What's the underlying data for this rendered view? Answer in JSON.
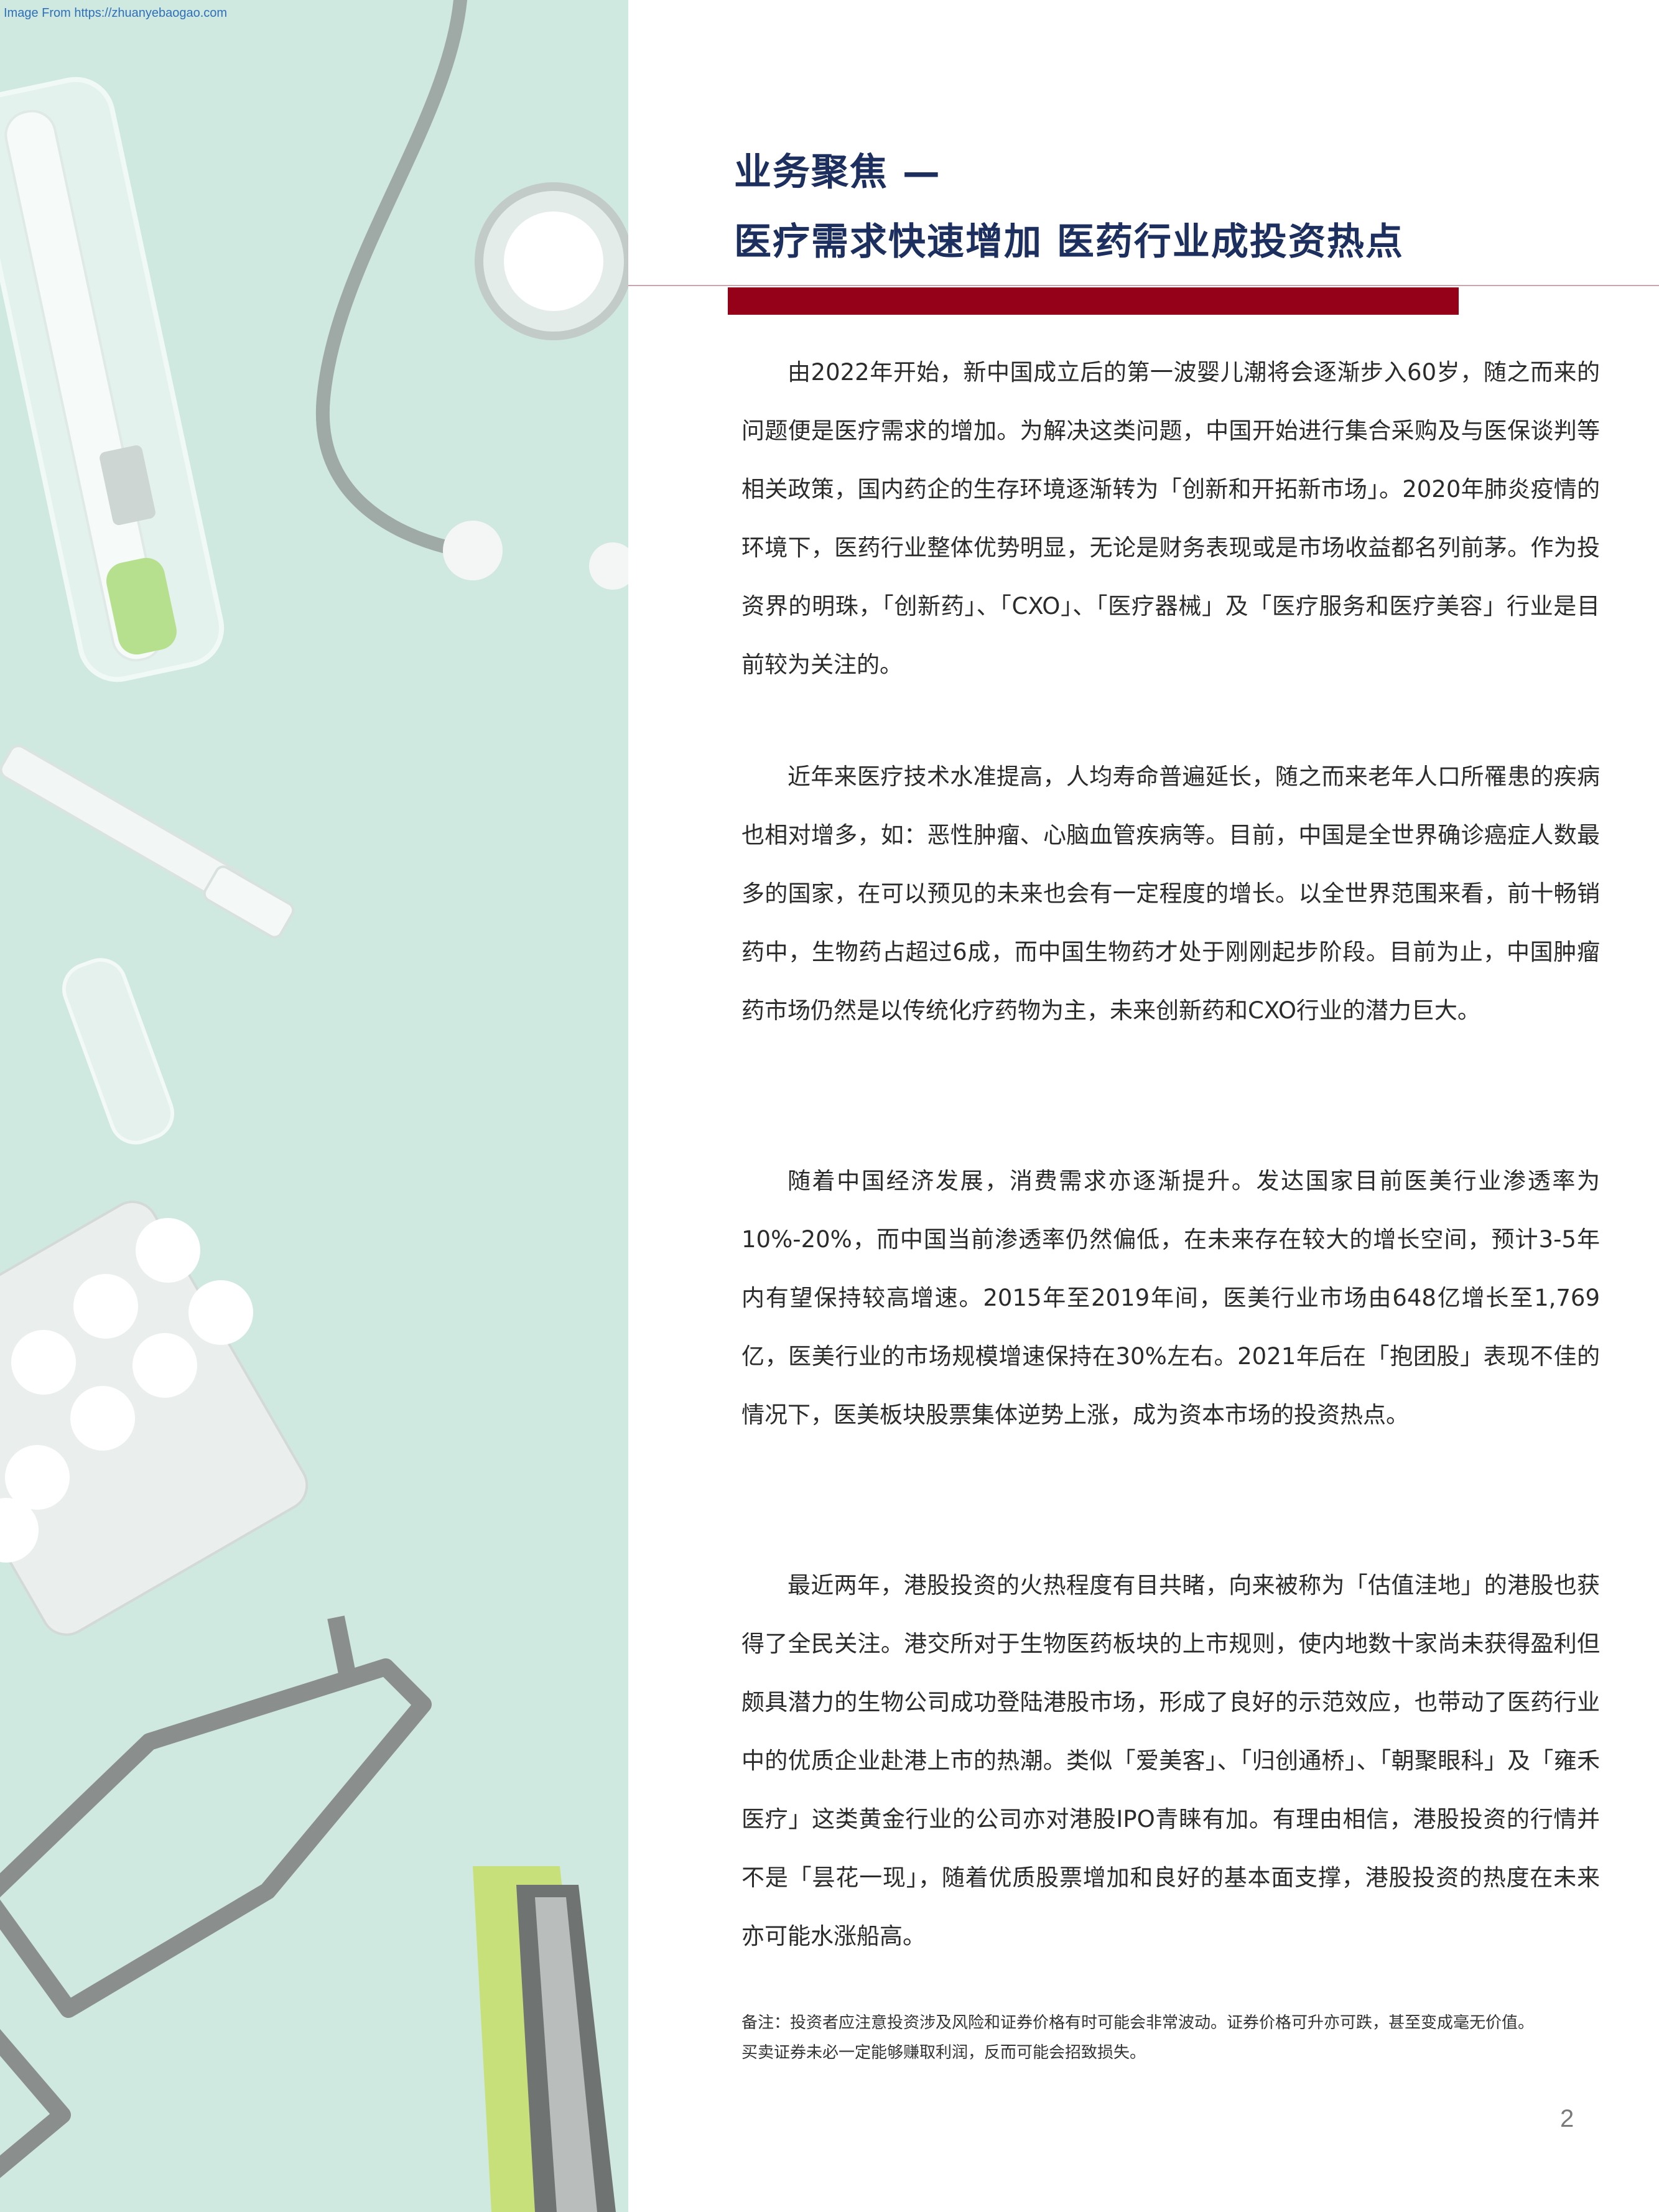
{
  "source_note": "Image From https://zhuanyebaogao.com",
  "title": {
    "line1": "业务聚焦 —",
    "line2": "医疗需求快速增加 医药行业成投资热点"
  },
  "paragraphs": [
    "由2022年开始，新中国成立后的第一波婴儿潮将会逐渐步入60岁，随之而来的问题便是医疗需求的增加。为解决这类问题，中国开始进行集合采购及与医保谈判等相关政策，国内药企的生存环境逐渐转为「创新和开拓新市场」。2020年肺炎疫情的环境下，医药行业整体优势明显，无论是财务表现或是市场收益都名列前茅。作为投资界的明珠，「创新药」、「CXO」、「医疗器械」及「医疗服务和医疗美容」行业是目前较为关注的。",
    "近年来医疗技术水准提高，人均寿命普遍延长，随之而来老年人口所罹患的疾病也相对增多，如：恶性肿瘤、心脑血管疾病等。目前，中国是全世界确诊癌症人数最多的国家，在可以预见的未来也会有一定程度的增长。以全世界范围来看，前十畅销药中，生物药占超过6成，而中国生物药才处于刚刚起步阶段。目前为止，中国肿瘤药市场仍然是以传统化疗药物为主，未来创新药和CXO行业的潜力巨大。",
    "随着中国经济发展，消费需求亦逐渐提升。发达国家目前医美行业渗透率为10%-20%，而中国当前渗透率仍然偏低，在未来存在较大的增长空间，预计3-5年内有望保持较高增速。2015年至2019年间，医美行业市场由648亿增长至1,769亿，医美行业的市场规模增速保持在30%左右。2021年后在「抱团股」表现不佳的情况下，医美板块股票集体逆势上涨，成为资本市场的投资热点。",
    "最近两年，港股投资的火热程度有目共睹，向来被称为「估值洼地」的港股也获得了全民关注。港交所对于生物医药板块的上市规则，使内地数十家尚未获得盈利但颇具潜力的生物公司成功登陆港股市场，形成了良好的示范效应，也带动了医药行业中的优质企业赴港上市的热潮。类似「爱美客」、「归创通桥」、「朝聚眼科」及「雍禾医疗」这类黄金行业的公司亦对港股IPO青睐有加。有理由相信，港股投资的行情并不是「昙花一现」，随着优质股票增加和良好的基本面支撑，港股投资的热度在未来亦可能水涨船高。"
  ],
  "footnote": {
    "line1": "备注：投资者应注意投资涉及风险和证券价格有时可能会非常波动。证券价格可升亦可跌，甚至变成毫无价值。",
    "line2": "买卖证券未必一定能够赚取利润，反而可能会招致损失。"
  },
  "page_number": "2",
  "colors": {
    "title": "#1c2f5e",
    "accent_bar": "#950118",
    "panel_background": "#cfe9e1"
  }
}
